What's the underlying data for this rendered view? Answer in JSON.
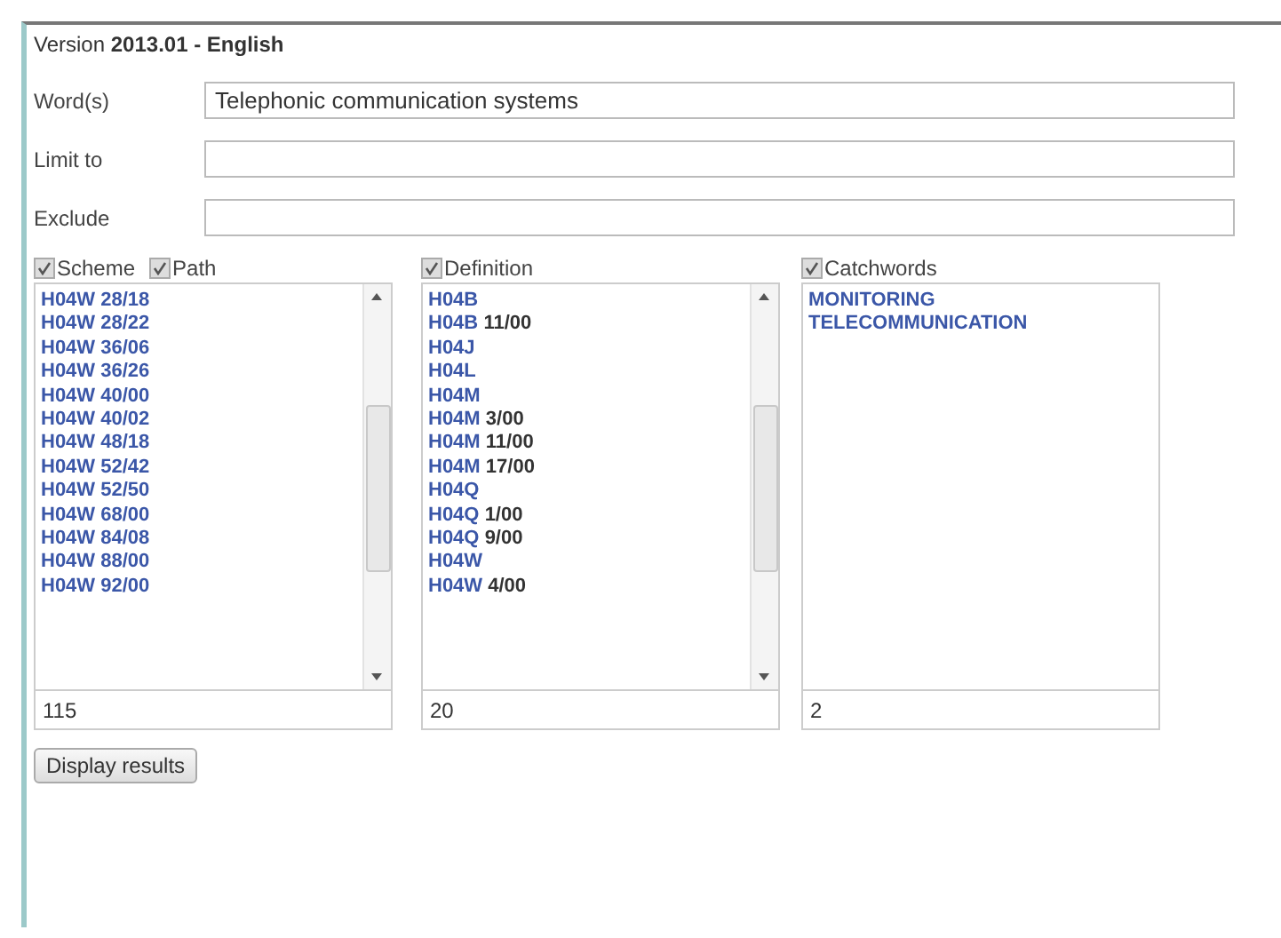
{
  "version": {
    "prefix": "Version",
    "number": "2013.01 - English"
  },
  "fields": [
    {
      "label": "Word(s)",
      "value": "Telephonic communication systems"
    },
    {
      "label": "Limit to"
    },
    {
      "label": "Exclude"
    }
  ],
  "lists": [
    {
      "toggles": [
        {
          "label": "Scheme",
          "checked": true
        },
        {
          "label": "Path",
          "checked": true
        }
      ],
      "scrollable": true,
      "items": [
        {
          "code": "H04W 28/18"
        },
        {
          "code": "H04W 28/22"
        },
        {
          "code": "H04W 36/06"
        },
        {
          "code": "H04W 36/26"
        },
        {
          "code": "H04W 40/00"
        },
        {
          "code": "H04W 40/02"
        },
        {
          "code": "H04W 48/18"
        },
        {
          "code": "H04W 52/42"
        },
        {
          "code": "H04W 52/50"
        },
        {
          "code": "H04W 68/00"
        },
        {
          "code": "H04W 84/08"
        },
        {
          "code": "H04W 88/00"
        },
        {
          "code": "H04W 92/00"
        }
      ],
      "count": "115"
    },
    {
      "toggles": [
        {
          "label": "Definition",
          "checked": true
        }
      ],
      "scrollable": true,
      "items": [
        {
          "code": "H04B"
        },
        {
          "code": "H04B",
          "sub": "11/00"
        },
        {
          "code": "H04J"
        },
        {
          "code": "H04L"
        },
        {
          "code": "H04M"
        },
        {
          "code": "H04M",
          "sub": "3/00"
        },
        {
          "code": "H04M",
          "sub": "11/00"
        },
        {
          "code": "H04M",
          "sub": "17/00"
        },
        {
          "code": "H04Q"
        },
        {
          "code": "H04Q",
          "sub": "1/00"
        },
        {
          "code": "H04Q",
          "sub": "9/00"
        },
        {
          "code": "H04W"
        },
        {
          "code": "H04W",
          "sub": "4/00"
        }
      ],
      "count": "20"
    },
    {
      "toggles": [
        {
          "label": "Catchwords",
          "checked": true
        }
      ],
      "items": [
        {
          "code": "MONITORING"
        },
        {
          "code": "TELECOMMUNICATION"
        }
      ],
      "count": "2"
    }
  ],
  "button": "Display results"
}
